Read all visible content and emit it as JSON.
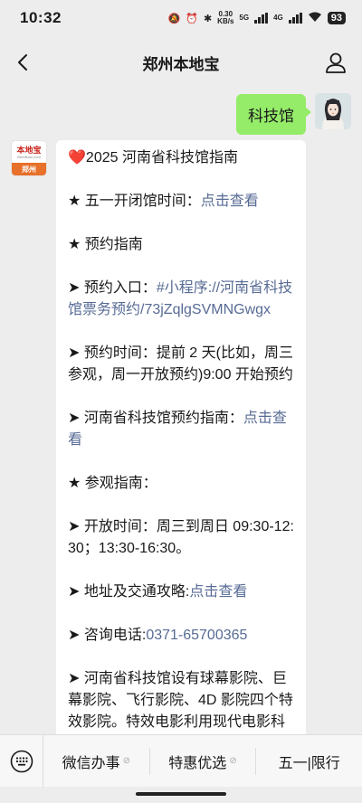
{
  "status": {
    "time": "10:32",
    "speed_top": "0.30",
    "speed_bottom": "KB/s",
    "net_5g": "5G",
    "net_4g": "4G",
    "battery": "93"
  },
  "navbar": {
    "title": "郑州本地宝"
  },
  "user_message": {
    "text": "科技馆"
  },
  "bot_avatar": {
    "brand": "本地宝",
    "brand_url": "Bendibao.com",
    "city": "郑州"
  },
  "bot_message": {
    "title": "2025 河南省科技馆指南",
    "title_icon": "❤️",
    "hours_label": "★ 五一开闭馆时间：",
    "hours_link": "点击查看",
    "booking_heading": "★ 预约指南",
    "entry_label": "➤ 预约入口：",
    "entry_link": "#小程序://河南省科技馆票务预约/73jZqlgSVMNGwgx",
    "time_text": "➤ 预约时间：提前 2 天(比如，周三参观，周一开放预约)9:00 开始预约",
    "guide_label": "➤ 河南省科技馆预约指南：",
    "guide_link": "点击查看",
    "visit_heading": "★ 参观指南：",
    "open_text": "➤ 开放时间：周三到周日 09:30-12:30；13:30-16:30。",
    "address_label": "➤ 地址及交通攻略:",
    "address_link": "点击查看",
    "phone_label": "➤ 咨询电话:",
    "phone_link": "0371-65700365",
    "theater_text": "➤ 河南省科技馆设有球幕影院、巨幕影院、飞行影院、4D 影院四个特效影院。特效电影利用现代电影科技手段，使观众产生身临其境"
  },
  "menu": {
    "items": [
      "微信办事",
      "特惠优选",
      "五一|限行"
    ]
  }
}
